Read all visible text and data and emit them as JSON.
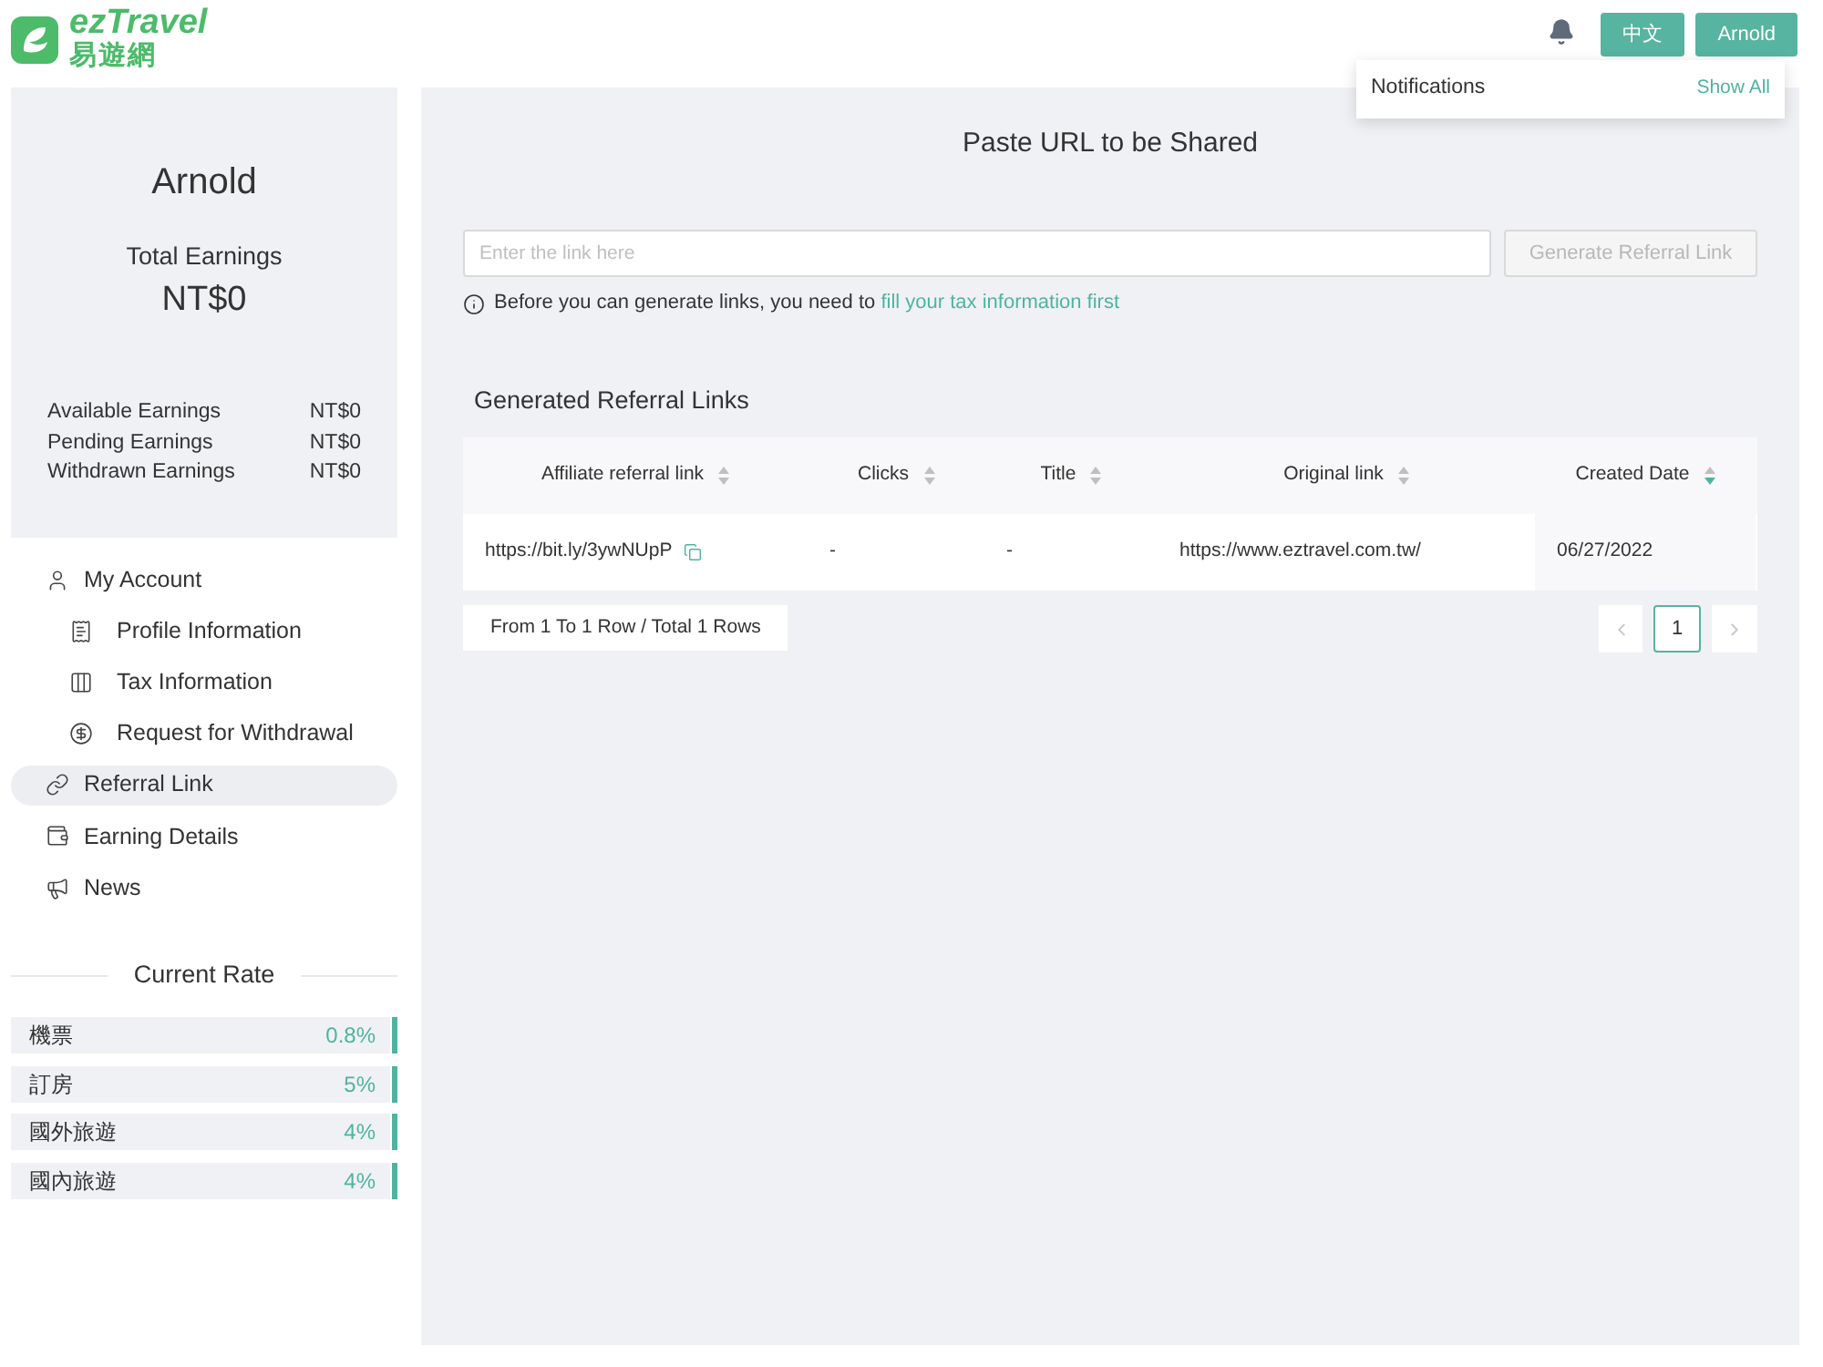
{
  "header": {
    "logo": {
      "wordmark": "ezTravel",
      "chinese_name": "易遊網"
    },
    "buttons": [
      {
        "label": "中文"
      },
      {
        "label": "Arnold"
      }
    ]
  },
  "notifications_popup": {
    "title": "Notifications",
    "link": "Show All"
  },
  "summary_card": {
    "name": "Arnold",
    "total_label": "Total Earnings",
    "total_value": "NT$0",
    "rows": [
      {
        "label": "Available Earnings",
        "value": "NT$0"
      },
      {
        "label": "Pending Earnings",
        "value": "NT$0"
      },
      {
        "label": "Withdrawn Earnings",
        "value": "NT$0"
      }
    ]
  },
  "sidebar": {
    "items": [
      {
        "label": "My Account",
        "kind": "account",
        "selected": false,
        "children": [
          {
            "label": "Profile Information",
            "kind": "profile",
            "selected": false
          },
          {
            "label": "Tax Information",
            "kind": "tax",
            "selected": false
          },
          {
            "label": "Request for Withdrawal",
            "kind": "withdrawal",
            "selected": false
          }
        ]
      },
      {
        "label": "Referral Link",
        "kind": "referral",
        "selected": true
      },
      {
        "label": "Earning Details",
        "kind": "earnings",
        "selected": false
      },
      {
        "label": "News",
        "kind": "news",
        "selected": false
      }
    ]
  },
  "current_rate": {
    "title": "Current Rate",
    "rates": [
      {
        "label": "機票",
        "value": "0.8%"
      },
      {
        "label": "訂房",
        "value": "5%"
      },
      {
        "label": "國外旅遊",
        "value": "4%"
      },
      {
        "label": "國內旅遊",
        "value": "4%"
      }
    ]
  },
  "main": {
    "title": "Paste URL to be Shared",
    "url_field": {
      "placeholder": "Enter the link here"
    },
    "generate_button": {
      "label": "Generate Referral Link",
      "disabled": true
    },
    "notice": {
      "text": "Before you can generate links, you need to",
      "link": "fill your tax information first"
    },
    "section_title": "Generated Referral Links",
    "table": {
      "columns": [
        {
          "label": "Affiliate referral link",
          "sorted_descending": false
        },
        {
          "label": "Clicks",
          "sorted_descending": false
        },
        {
          "label": "Title",
          "sorted_descending": false
        },
        {
          "label": "Original link",
          "sorted_descending": false
        },
        {
          "label": "Created Date",
          "sorted_descending": true
        }
      ],
      "rows": [
        {
          "cells": [
            "https://bit.ly/3ywNUpP",
            "-",
            "-",
            "https://www.eztravel.com.tw/",
            "06/27/2022"
          ]
        }
      ]
    },
    "row_summary": "From 1 To 1 Row / Total 1 Rows",
    "pagination": {
      "prev": {
        "disabled": true
      },
      "pages": [
        {
          "label": "1",
          "selected": true
        }
      ],
      "next": {
        "disabled": true
      }
    }
  }
}
